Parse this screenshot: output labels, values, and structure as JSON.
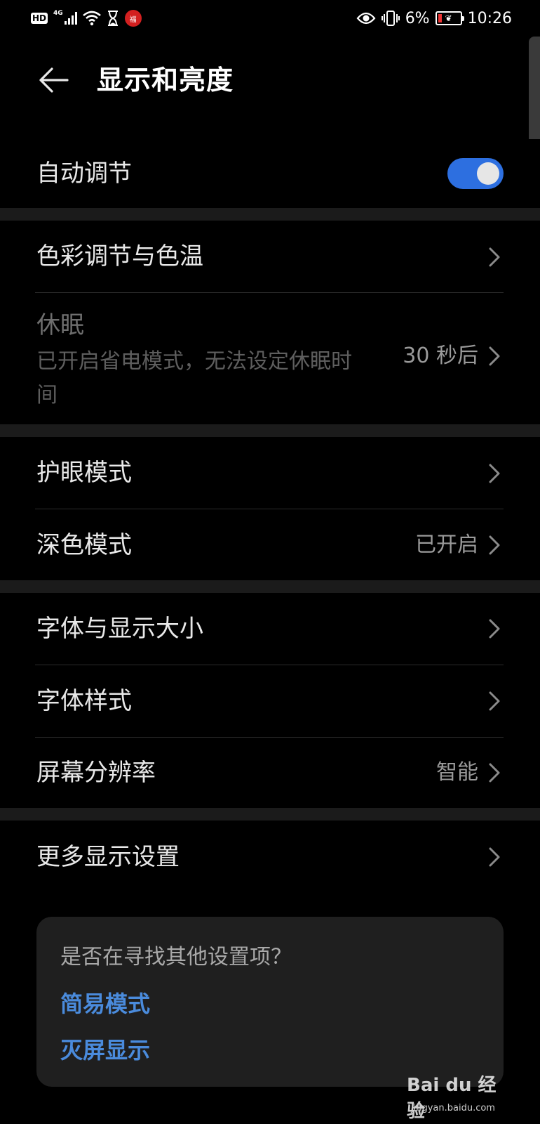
{
  "status_bar": {
    "hd_label": "HD",
    "network_label": "4G",
    "notify_badge": "福",
    "battery_percent": "6%",
    "battery_level": 0.06,
    "time": "10:26"
  },
  "header": {
    "title": "显示和亮度"
  },
  "auto_adjust": {
    "label": "自动调节",
    "enabled": true
  },
  "group1": {
    "color_temp_label": "色彩调节与色温",
    "sleep_label": "休眠",
    "sleep_subtitle": "已开启省电模式，无法设定休眠时间",
    "sleep_value": "30 秒后"
  },
  "group2": {
    "eye_comfort_label": "护眼模式",
    "dark_mode_label": "深色模式",
    "dark_mode_value": "已开启"
  },
  "group3": {
    "font_size_label": "字体与显示大小",
    "font_style_label": "字体样式",
    "resolution_label": "屏幕分辨率",
    "resolution_value": "智能"
  },
  "group4": {
    "more_label": "更多显示设置"
  },
  "suggestions": {
    "title": "是否在寻找其他设置项？",
    "links": [
      "简易模式",
      "灭屏显示"
    ]
  },
  "watermark": {
    "brand": "Bai du 经验",
    "site": "jingyan.baidu.com"
  },
  "colors": {
    "accent": "#4a8bdc",
    "toggle_on": "#2d6fe0",
    "background": "#000000",
    "separator": "#1b1b1b"
  }
}
